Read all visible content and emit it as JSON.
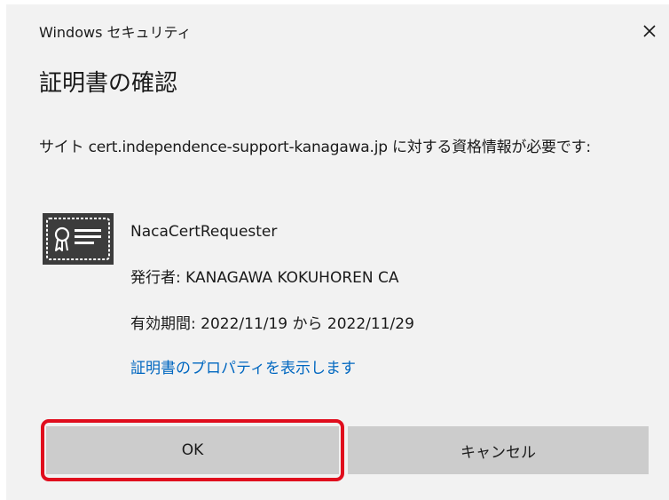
{
  "window": {
    "title": "Windows セキュリティ",
    "close_icon": "close-icon"
  },
  "dialog": {
    "heading": "証明書の確認",
    "message": "サイト cert.independence-support-kanagawa.jp に対する資格情報が必要です:"
  },
  "certificate": {
    "icon": "certificate-icon",
    "name": "NacaCertRequester",
    "issuer": "発行者: KANAGAWA KOKUHOREN CA",
    "validity": "有効期間: 2022/11/19 から 2022/11/29",
    "properties_link": "証明書のプロパティを表示します"
  },
  "buttons": {
    "ok_label": "OK",
    "cancel_label": "キャンセル"
  },
  "colors": {
    "dialog_background": "#f2f2f2",
    "button_background": "#cccccc",
    "link": "#0067c0",
    "highlight": "#e00d1d"
  }
}
